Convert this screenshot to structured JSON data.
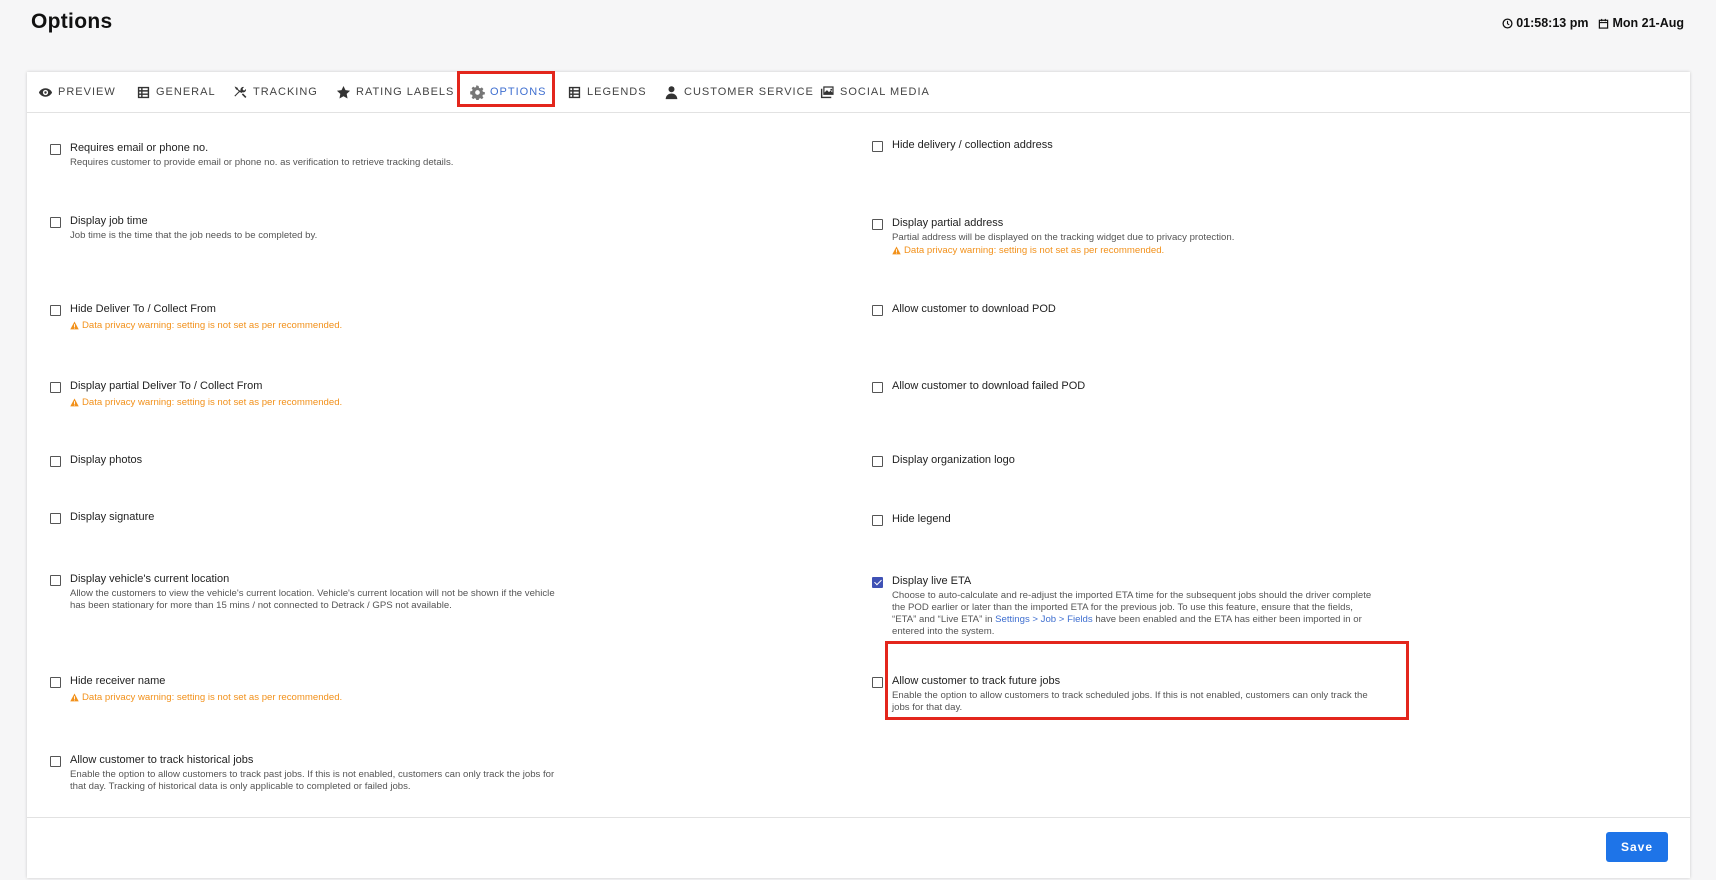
{
  "page": {
    "title": "Options"
  },
  "topbar": {
    "time": "01:58:13 pm",
    "date": "Mon 21-Aug"
  },
  "tabs": [
    {
      "label": "PREVIEW",
      "icon": "eye-icon"
    },
    {
      "label": "GENERAL",
      "icon": "list-icon"
    },
    {
      "label": "TRACKING",
      "icon": "tools-icon"
    },
    {
      "label": "RATING LABELS",
      "icon": "star-icon"
    },
    {
      "label": "OPTIONS",
      "icon": "gear-icon",
      "active": true
    },
    {
      "label": "LEGENDS",
      "icon": "list-icon"
    },
    {
      "label": "CUSTOMER SERVICE",
      "icon": "person-icon"
    },
    {
      "label": "SOCIAL MEDIA",
      "icon": "images-icon"
    }
  ],
  "warning_text": "Data privacy warning: setting is not set as per recommended.",
  "left_options": [
    {
      "label": "Requires email or phone no.",
      "desc": "Requires customer to provide email or phone no. as verification to retrieve tracking details.",
      "checked": false
    },
    {
      "label": "Display job time",
      "desc": "Job time is the time that the job needs to be completed by.",
      "checked": false
    },
    {
      "label": "Hide Deliver To / Collect From",
      "checked": false
    },
    {
      "label": "Display partial Deliver To / Collect From",
      "checked": false
    },
    {
      "label": "Display photos",
      "checked": false
    },
    {
      "label": "Display signature",
      "checked": false
    },
    {
      "label": "Display vehicle's current location",
      "desc": "Allow the customers to view the vehicle's current location. Vehicle's current location will not be shown if the vehicle has been stationary for more than 15 mins / not connected to Detrack / GPS not available.",
      "checked": false
    },
    {
      "label": "Hide receiver name",
      "checked": false
    },
    {
      "label": "Allow customer to track historical jobs",
      "desc": "Enable the option to allow customers to track past jobs. If this is not enabled, customers can only track the jobs for that day. Tracking of historical data is only applicable to completed or failed jobs.",
      "checked": false
    }
  ],
  "right_options": [
    {
      "label": "Hide delivery / collection address",
      "checked": false
    },
    {
      "label": "Display partial address",
      "desc": "Partial address will be displayed on the tracking widget due to privacy protection.",
      "checked": false
    },
    {
      "label": "Allow customer to download POD",
      "checked": false
    },
    {
      "label": "Allow customer to download failed POD",
      "checked": false
    },
    {
      "label": "Display organization logo",
      "checked": false
    },
    {
      "label": "Hide legend",
      "checked": false
    },
    {
      "label": "Display live ETA",
      "desc_before": "Choose to auto-calculate and re-adjust the imported ETA time for the subsequent jobs should the driver complete the POD earlier or later than the imported ETA for the previous job. To use this feature, ensure that the fields, “ETA” and “Live ETA” in ",
      "desc_link": "Settings > Job > Fields",
      "desc_after": " have been enabled and the ETA has either been imported in or entered into the system.",
      "checked": true
    },
    {
      "label": "Allow customer to track future jobs",
      "desc": "Enable the option to allow customers to track scheduled jobs. If this is not enabled, customers can only track the jobs for that day.",
      "checked": false
    }
  ],
  "footer": {
    "save_label": "Save"
  },
  "colors": {
    "accent": "#3f6fd0",
    "warning": "#f2911b",
    "highlight": "#e3261c",
    "save_button": "#1e74e8"
  }
}
